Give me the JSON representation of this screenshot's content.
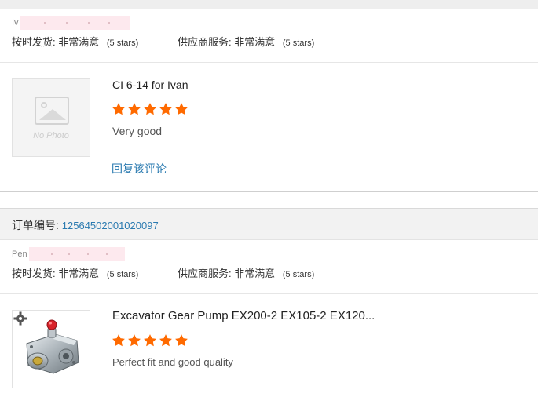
{
  "reviews": [
    {
      "buyer_prefix": "Iv",
      "ratings": {
        "shipping_label": "按时发货:",
        "shipping_value": "非常满意",
        "shipping_stars": "(5 stars)",
        "service_label": "供应商服务:",
        "service_value": "非常满意",
        "service_stars": "(5 stars)"
      },
      "product_title": "CI 6-14 for Ivan",
      "rating": 5,
      "comment": "Very good",
      "no_photo_label": "No Photo",
      "reply_label": "回复该评论"
    },
    {
      "order_label": "订单编号:",
      "order_number": "12564502001020097",
      "buyer_prefix": "Pen",
      "ratings": {
        "shipping_label": "按时发货:",
        "shipping_value": "非常满意",
        "shipping_stars": "(5 stars)",
        "service_label": "供应商服务:",
        "service_value": "非常满意",
        "service_stars": "(5 stars)"
      },
      "product_title": "Excavator Gear Pump EX200-2 EX105-2 EX120...",
      "rating": 5,
      "comment": "Perfect fit and good quality"
    }
  ],
  "colors": {
    "star": "#ff6a00",
    "link": "#2a7ab0",
    "masked": "#fde9ee"
  },
  "icons": {
    "star": "star-icon",
    "no_photo": "no-photo-icon",
    "badge": "gear-badge-icon"
  }
}
